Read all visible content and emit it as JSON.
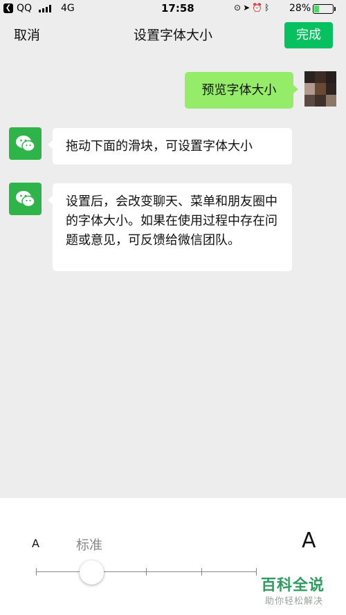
{
  "status_bar": {
    "carrier": "QQ",
    "network": "4G",
    "time": "17:58",
    "battery_percent": "28%",
    "battery_level": 0.28,
    "icons": [
      "back-arrow-icon",
      "signal-bars-icon",
      "lock-rotation-icon",
      "location-icon",
      "alarm-icon",
      "bluetooth-icon",
      "battery-icon"
    ]
  },
  "nav": {
    "cancel_label": "取消",
    "title": "设置字体大小",
    "done_label": "完成"
  },
  "chat": {
    "messages": [
      {
        "from": "me",
        "text": "预览字体大小"
      },
      {
        "from": "wechat",
        "text": "拖动下面的滑块，可设置字体大小"
      },
      {
        "from": "wechat",
        "text": "设置后，会改变聊天、菜单和朋友圈中的字体大小。如果在使用过程中存在问题或意见，可反馈给微信团队。"
      }
    ]
  },
  "font_slider": {
    "small_label": "A",
    "standard_label": "标准",
    "large_label": "A",
    "steps": 5,
    "selected_step": 1
  },
  "watermark": {
    "main": "百科全说",
    "sub": "助你轻松解决"
  },
  "colors": {
    "accent_green": "#07c160",
    "outgoing_bubble": "#95ec69",
    "wechat_avatar": "#2fb44a",
    "battery_fill": "#4cd964",
    "background": "#ededed"
  }
}
